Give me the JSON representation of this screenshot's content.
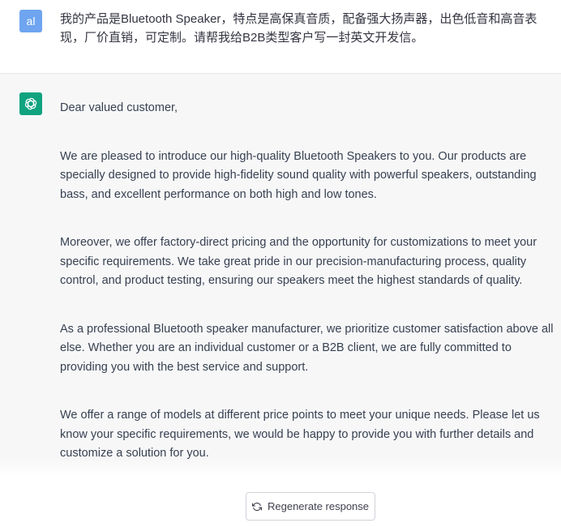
{
  "user_message": {
    "avatar_text": "al",
    "text": "我的产品是Bluetooth Speaker，特点是高保真音质，配备强大扬声器，出色低音和高音表现，厂价直销，可定制。请帮我给B2B类型客户写一封英文开发信。"
  },
  "assistant_message": {
    "icon": "openai-logo-icon",
    "paragraphs": [
      "Dear valued customer,",
      "We are pleased to introduce our high-quality Bluetooth Speakers to you. Our products are specially designed to provide high-fidelity sound quality with powerful speakers, outstanding bass, and excellent performance on both high and low tones.",
      "Moreover, we offer factory-direct pricing and the opportunity for customizations to meet your specific requirements. We take great pride in our precision-manufacturing process, quality control, and product testing, ensuring our speakers meet the highest standards of quality.",
      "As a professional Bluetooth speaker manufacturer, we prioritize customer satisfaction above all else. Whether you are an individual customer or a B2B client, we are fully committed to providing you with the best service and support.",
      "We offer a range of models at different price points to meet your unique needs. Please let us know your specific requirements, we would be happy to provide you with further details and customize a solution for you."
    ]
  },
  "controls": {
    "regenerate_label": "Regenerate response",
    "regenerate_icon": "refresh-icon"
  },
  "colors": {
    "user_avatar_bg": "#6ea4f0",
    "assistant_avatar_bg": "#10a37f",
    "assistant_row_bg": "#f7f7f8"
  }
}
